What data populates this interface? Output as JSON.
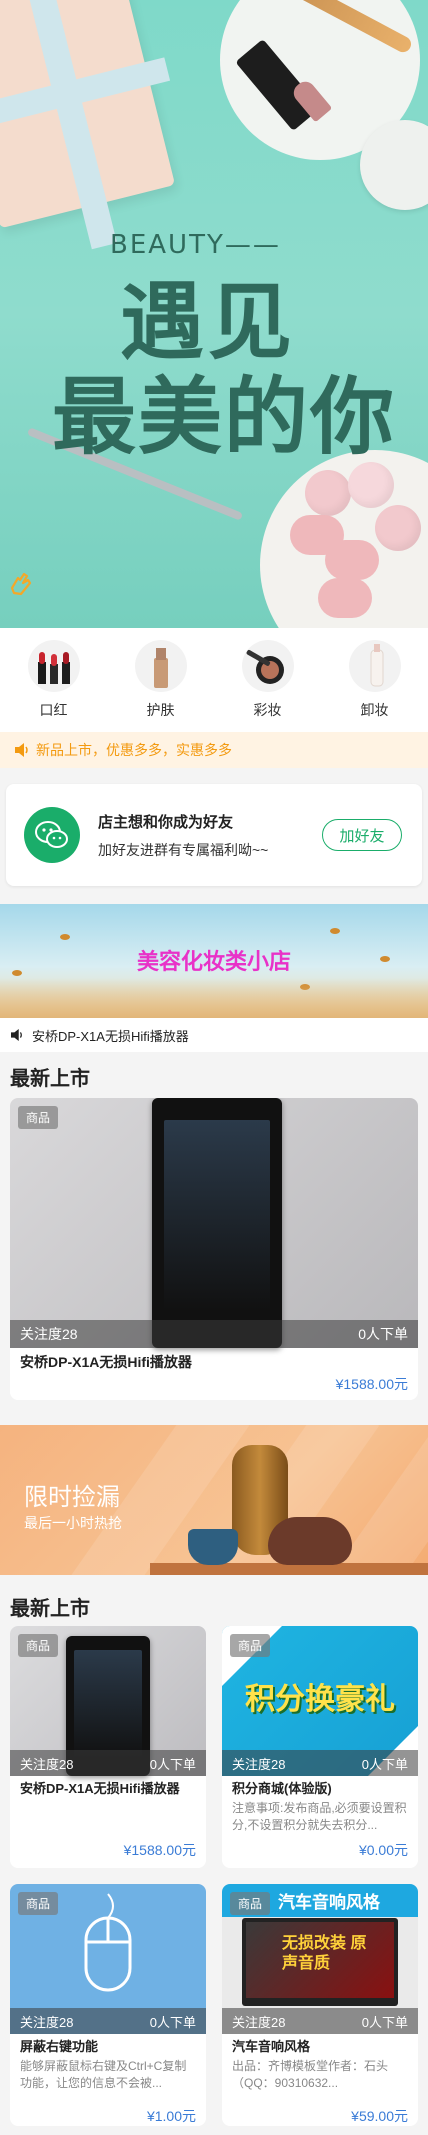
{
  "hero": {
    "headline_small": "BEAUTY——",
    "headline_line1": "遇见",
    "headline_line2": "最美的你"
  },
  "categories": [
    {
      "label": "口红",
      "icon": "lipstick-icon"
    },
    {
      "label": "护肤",
      "icon": "skincare-bottle-icon"
    },
    {
      "label": "彩妆",
      "icon": "makeup-compact-icon"
    },
    {
      "label": "卸妆",
      "icon": "makeup-remover-icon"
    }
  ],
  "notice": {
    "text": "新品上市，优惠多多，实惠多多",
    "color": "#f39a10"
  },
  "friend_card": {
    "title": "店主想和你成为好友",
    "subtitle": "加好友进群有专属福利呦~~",
    "button": "加好友",
    "accent": "#1aad6a"
  },
  "shop_banner": {
    "title": "美容化妆类小店"
  },
  "scroll_notice": {
    "text": "安桥DP-X1A无损Hifi播放器"
  },
  "section1": {
    "title": "最新上市"
  },
  "featured": {
    "tag": "商品",
    "attention": "关注度28",
    "orders": "0人下单",
    "name": "安桥DP-X1A无损Hifi播放器",
    "price": "¥1588.00元"
  },
  "sale_banner": {
    "title": "限时捡漏",
    "subtitle": "最后一小时热抢"
  },
  "section2": {
    "title": "最新上市"
  },
  "grid": [
    {
      "tag": "商品",
      "attention": "关注度28",
      "orders": "0人下单",
      "name": "安桥DP-X1A无损Hifi播放器",
      "desc": "",
      "price": "¥1588.00元"
    },
    {
      "tag": "商品",
      "attention": "关注度28",
      "orders": "0人下单",
      "name": "积分商城(体验版)",
      "desc": "注意事项:发布商品,必须要设置积分,不设置积分就失去积分...",
      "price": "¥0.00元",
      "banner_text": "积分换豪礼"
    },
    {
      "tag": "商品",
      "attention": "关注度28",
      "orders": "0人下单",
      "name": "屏蔽右键功能",
      "desc": "能够屏蔽鼠标右键及Ctrl+C复制功能，让您的信息不会被...",
      "price": "¥1.00元"
    },
    {
      "tag": "商品",
      "attention": "关注度28",
      "orders": "0人下单",
      "name": "汽车音响风格",
      "desc": "出品：齐博模板堂作者：石头（QQ：90310632...",
      "price": "¥59.00元",
      "banner_text": "汽车音响风格",
      "inner_text": "无损改装 原声音质"
    }
  ],
  "colors": {
    "price": "#3b7cd6",
    "hero_text": "#2f6a5c",
    "shop_title": "#e832c8"
  }
}
